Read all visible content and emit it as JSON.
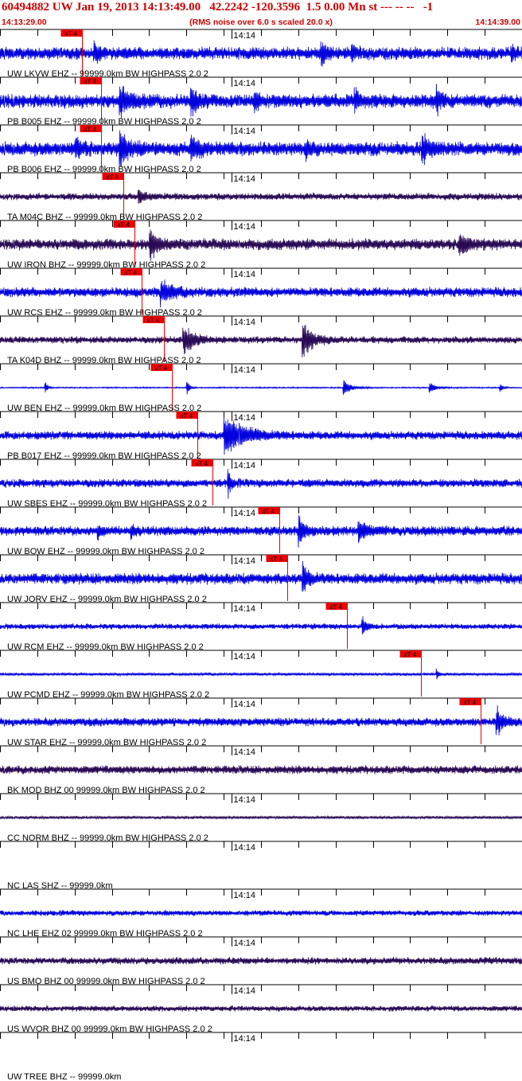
{
  "header": {
    "title": "60494882 UW Jan 19, 2013 14:13:49.00   42.2242 -120.3596  1.5 0.00 Mn st --- -- --   -1",
    "start_time": "14:13:29.00",
    "noise_note": "(RMS noise over 6.0 s scaled 20.0 x)",
    "end_time": "14:14:39.00"
  },
  "chart_data": {
    "type": "line",
    "title": "60494882 UW Jan 19, 2013 14:13:49.00   42.2242 -120.3596  1.5 0.00 Mn st --- -- --   -1",
    "x_range": [
      "14:13:29.00",
      "14:14:39.00"
    ],
    "x_range_seconds": [
      0,
      70
    ],
    "minute_tick_label": "14:14",
    "minute_tick_seconds": 31,
    "tick_interval_seconds": 5,
    "pick_label": "xT 4",
    "colors": {
      "blue": "#0000dd",
      "purple": "#2a0a55",
      "pick": "#ee0000",
      "text": "#cc0000"
    },
    "traces": [
      {
        "label": "UW LKVW EHZ -- 99999.0km BW  HIGHPASS  2.0  2",
        "color": "blue",
        "pick_s": 11.0,
        "amp": 9,
        "bursts": [
          [
            12.5,
            14,
            0.7
          ],
          [
            43,
            16,
            0.8
          ],
          [
            47,
            12,
            0.6
          ],
          [
            68.5,
            14,
            0.5
          ]
        ]
      },
      {
        "label": "PB B005 EHZ -- 99999.0km BW  HIGHPASS  2.0  2",
        "color": "blue",
        "pick_s": 13.5,
        "amp": 10,
        "bursts": [
          [
            16,
            22,
            1.1
          ],
          [
            25.5,
            18,
            0.9
          ],
          [
            34,
            16,
            0.6
          ],
          [
            47.5,
            16,
            0.6
          ],
          [
            58.5,
            15,
            0.6
          ]
        ]
      },
      {
        "label": "PB B006 EHZ -- 99999.0km BW  HIGHPASS  2.0  2",
        "color": "blue",
        "pick_s": 13.5,
        "amp": 10,
        "bursts": [
          [
            10,
            14,
            1.0
          ],
          [
            16,
            24,
            1.2
          ],
          [
            25.5,
            20,
            1.0
          ],
          [
            41,
            16,
            0.6
          ],
          [
            56.5,
            20,
            0.9
          ]
        ]
      },
      {
        "label": "TA M04C BHZ -- 99999.0km BW  HIGHPASS  2.0  2",
        "color": "purple",
        "pick_s": 16.5,
        "amp": 5,
        "bursts": [
          [
            18.5,
            14,
            0.6
          ]
        ]
      },
      {
        "label": "UW IRON BHZ -- 99999.0km BW  HIGHPASS  2.0  2",
        "color": "purple",
        "pick_s": 18.0,
        "amp": 8,
        "bursts": [
          [
            20,
            22,
            0.9
          ],
          [
            61.5,
            20,
            0.8
          ]
        ]
      },
      {
        "label": "UW RCS EHZ -- 99999.0km BW  HIGHPASS  2.0  2",
        "color": "blue",
        "pick_s": 19.0,
        "amp": 7,
        "bursts": [
          [
            21.5,
            18,
            1.3
          ]
        ]
      },
      {
        "label": "TA K04D BHZ -- 99999.0km BW  HIGHPASS  2.0  2",
        "color": "purple",
        "pick_s": 22.0,
        "amp": 5,
        "bursts": [
          [
            24.5,
            24,
            1.2
          ],
          [
            40.5,
            30,
            1.2
          ]
        ]
      },
      {
        "label": "UW BEN EHZ -- 99999.0km BW  HIGHPASS  2.0  2",
        "color": "blue",
        "pick_s": 23.0,
        "amp": 1,
        "bursts": [
          [
            6,
            12,
            0.3
          ],
          [
            25,
            16,
            0.3
          ],
          [
            46,
            12,
            1.0
          ],
          [
            57.5,
            10,
            0.8
          ],
          [
            67,
            10,
            0.3
          ]
        ]
      },
      {
        "label": "PB B017 EHZ -- 99999.0km BW  HIGHPASS  2.0  2",
        "color": "blue",
        "pick_s": 26.5,
        "amp": 6,
        "bursts": [
          [
            30,
            30,
            2.5
          ]
        ]
      },
      {
        "label": "UW SBES EHZ -- 99999.0km BW  HIGHPASS  2.0  2",
        "color": "blue",
        "pick_s": 28.5,
        "amp": 6,
        "bursts": [
          [
            30.5,
            26,
            0.35
          ]
        ]
      },
      {
        "label": "UW BOW EHZ -- 99999.0km BW  HIGHPASS  2.0  2",
        "color": "blue",
        "pick_s": 37.5,
        "amp": 7,
        "bursts": [
          [
            13,
            10,
            0.5
          ],
          [
            17.5,
            10,
            0.4
          ],
          [
            40,
            20,
            0.8
          ],
          [
            48,
            16,
            1.0
          ]
        ]
      },
      {
        "label": "UW JORV EHZ -- 99999.0km BW  HIGHPASS  2.0  2",
        "color": "blue",
        "pick_s": 38.5,
        "amp": 8,
        "bursts": [
          [
            40.5,
            22,
            0.8
          ]
        ]
      },
      {
        "label": "UW RCM EHZ -- 99999.0km BW  HIGHPASS  2.0  2",
        "color": "blue",
        "pick_s": 46.5,
        "amp": 4,
        "bursts": [
          [
            48.5,
            14,
            0.6
          ]
        ]
      },
      {
        "label": "UW PCMD EHZ -- 99999.0km BW  HIGHPASS  2.0  2",
        "color": "blue",
        "pick_s": 56.5,
        "amp": 2,
        "bursts": [
          [
            58.5,
            8,
            0.4
          ]
        ]
      },
      {
        "label": "UW STAR EHZ -- 99999.0km BW  HIGHPASS  2.0  2",
        "color": "blue",
        "pick_s": 64.5,
        "amp": 6,
        "bursts": [
          [
            66.5,
            22,
            0.9
          ]
        ]
      },
      {
        "label": "BK MOD BHZ 00 99999.0km BW  HIGHPASS  2.0  2",
        "color": "purple",
        "pick_s": null,
        "amp": 6,
        "bursts": []
      },
      {
        "label": "CC NORM BHZ -- 99999.0km BW  HIGHPASS  2.0  2",
        "color": "purple",
        "pick_s": null,
        "amp": 2,
        "bursts": []
      },
      {
        "label": "NC LAS SHZ -- 99999.0km",
        "color": "none",
        "pick_s": null,
        "amp": 0,
        "bursts": []
      },
      {
        "label": "NC LHE EHZ 02 99999.0km BW  HIGHPASS  2.0  2",
        "color": "blue",
        "pick_s": null,
        "amp": 4,
        "bursts": []
      },
      {
        "label": "US BMO BHZ 00 99999.0km BW  HIGHPASS  2.0  2",
        "color": "purple",
        "pick_s": null,
        "amp": 5,
        "bursts": []
      },
      {
        "label": "US WVOR BHZ 00 99999.0km BW  HIGHPASS  2.0  2",
        "color": "purple",
        "pick_s": null,
        "amp": 4,
        "bursts": []
      },
      {
        "label": "UW TREE BHZ -- 99999.0km",
        "color": "none",
        "pick_s": null,
        "amp": 0,
        "bursts": []
      }
    ]
  }
}
